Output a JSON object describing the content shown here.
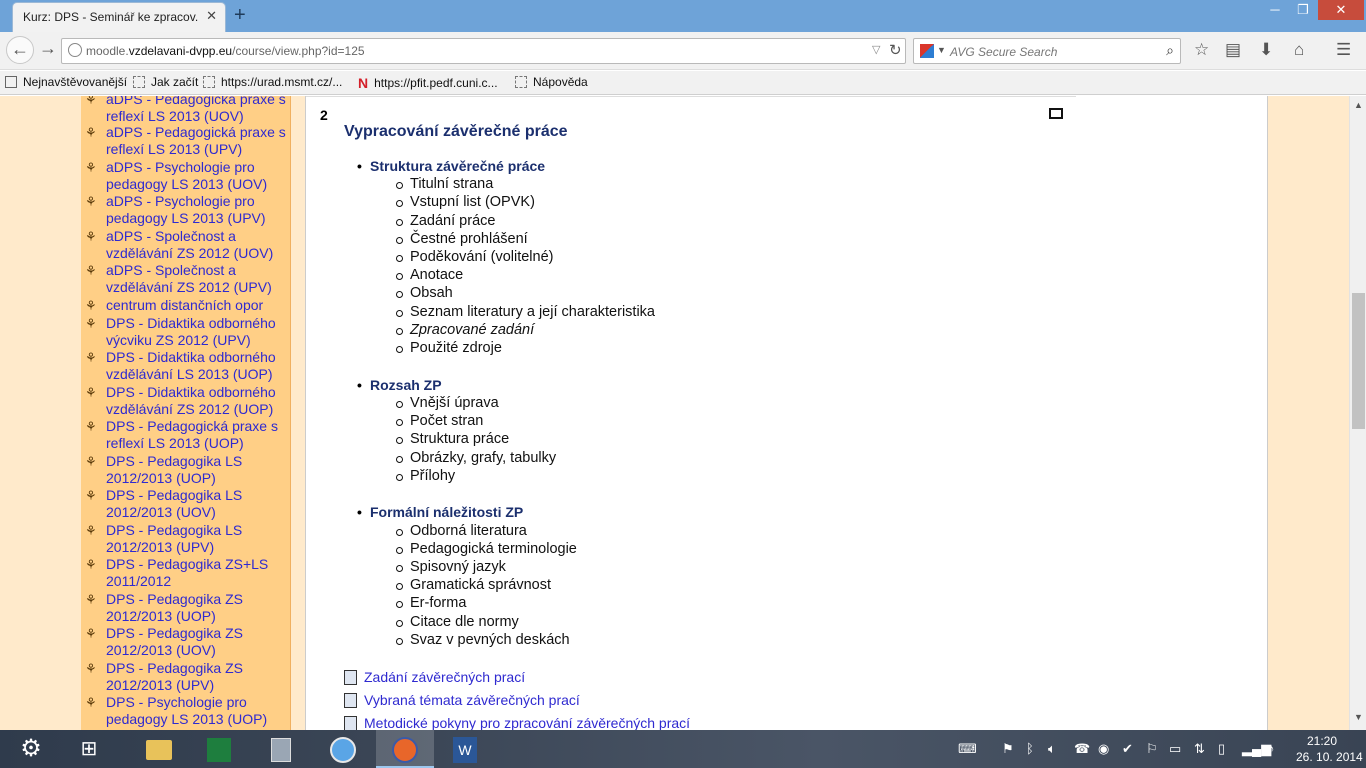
{
  "browser": {
    "tab_title": "Kurz: DPS - Seminář ke zpracov...",
    "tab_close": "✕",
    "new_tab": "+",
    "win_min": "─",
    "win_max": "❐",
    "win_close": "✕",
    "url_prefix": "moodle.",
    "url_domain": "vzdelavani-dvpp.eu",
    "url_path": "/course/view.php?id=125",
    "search_placeholder": "AVG Secure Search"
  },
  "bookmarks": [
    {
      "label": "Nejnavštěvovanější"
    },
    {
      "label": "Jak začít"
    },
    {
      "label": "https://urad.msmt.cz/..."
    },
    {
      "label": "https://pfit.pedf.cuni.c..."
    },
    {
      "label": "Nápověda"
    }
  ],
  "courses": [
    "aDPS - Pedagogická praxe s reflexí LS 2013 (UOV)",
    "aDPS - Pedagogická praxe s reflexí LS 2013 (UPV)",
    "aDPS - Psychologie pro pedagogy LS 2013 (UOV)",
    "aDPS - Psychologie pro pedagogy LS 2013 (UPV)",
    "aDPS - Společnost a vzdělávání ZS 2012 (UOV)",
    "aDPS - Společnost a vzdělávání ZS 2012 (UPV)",
    "centrum distančních opor",
    "DPS - Didaktika odborného výcviku ZS 2012 (UPV)",
    "DPS - Didaktika odborného vzdělávání LS 2013 (UOP)",
    "DPS - Didaktika odborného vzdělávání ZS 2012 (UOP)",
    "DPS - Pedagogická praxe s reflexí LS 2013 (UOP)",
    "DPS - Pedagogika LS 2012/2013 (UOP)",
    "DPS - Pedagogika LS 2012/2013 (UOV)",
    "DPS - Pedagogika LS 2012/2013 (UPV)",
    "DPS - Pedagogika ZS+LS 2011/2012",
    "DPS - Pedagogika ZS 2012/2013 (UOP)",
    "DPS - Pedagogika ZS 2012/2013 (UOV)",
    "DPS - Pedagogika ZS 2012/2013 (UPV)",
    "DPS - Psychologie pro pedagogy LS 2013 (UOP)"
  ],
  "topic": {
    "number": "2",
    "title": "Vypracování závěrečné práce",
    "groups": [
      {
        "heading": "Struktura závěrečné práce",
        "items": [
          "Titulní strana",
          "Vstupní list (OPVK)",
          "Zadání práce",
          "Čestné prohlášení",
          "Poděkování (volitelné)",
          "Anotace",
          "Obsah",
          "Seznam literatury a její charakteristika",
          "Zpracované zadání",
          "Použité zdroje"
        ]
      },
      {
        "heading": "Rozsah ZP",
        "items": [
          "Vnější úprava",
          "Počet stran",
          "Struktura práce",
          "Obrázky, grafy, tabulky",
          "Přílohy"
        ]
      },
      {
        "heading": "Formální náležitosti ZP",
        "items": [
          "Odborná literatura",
          "Pedagogická terminologie",
          "Spisovný jazyk",
          "Gramatická správnost",
          "Er-forma",
          "Citace dle normy",
          "Svaz v pevných deskách"
        ]
      }
    ],
    "resources": [
      "Zadání závěrečných prací",
      "Vybraná témata závěrečných prací",
      "Metodické pokyny pro zpracování závěrečných prací"
    ]
  },
  "taskbar": {
    "time": "21:20",
    "date": "26. 10. 2014"
  }
}
